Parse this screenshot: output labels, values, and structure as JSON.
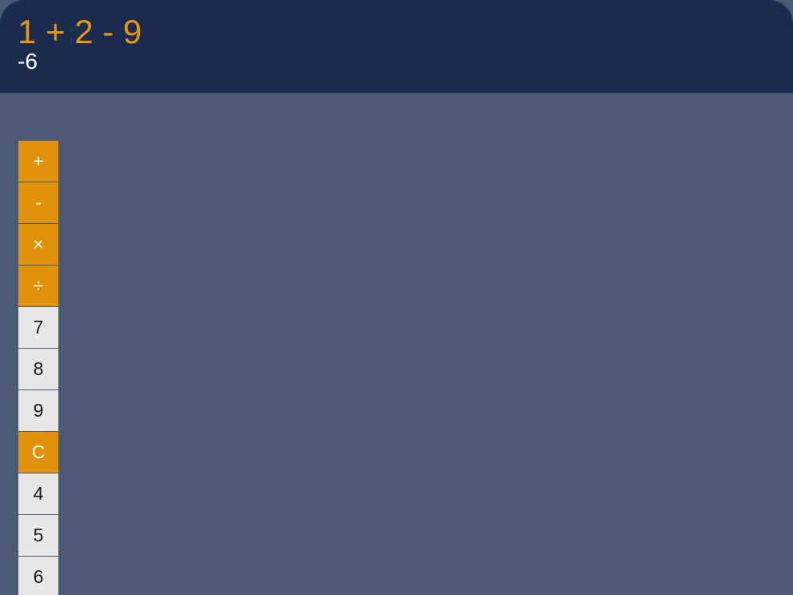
{
  "display": {
    "expression": "1 + 2 - 9",
    "result": "-6"
  },
  "keys": [
    {
      "label": "+",
      "kind": "op",
      "name": "add-button"
    },
    {
      "label": "-",
      "kind": "op",
      "name": "subtract-button"
    },
    {
      "label": "×",
      "kind": "op",
      "name": "multiply-button"
    },
    {
      "label": "÷",
      "kind": "op",
      "name": "divide-button"
    },
    {
      "label": "7",
      "kind": "num",
      "name": "digit-7-button"
    },
    {
      "label": "8",
      "kind": "num",
      "name": "digit-8-button"
    },
    {
      "label": "9",
      "kind": "num",
      "name": "digit-9-button"
    },
    {
      "label": "C",
      "kind": "clear",
      "name": "clear-button"
    },
    {
      "label": "4",
      "kind": "num",
      "name": "digit-4-button"
    },
    {
      "label": "5",
      "kind": "num",
      "name": "digit-5-button"
    },
    {
      "label": "6",
      "kind": "num",
      "name": "digit-6-button"
    }
  ],
  "colors": {
    "accent": "#e1900a",
    "display_bg": "#1c2b50",
    "body_bg": "#4c5a73",
    "number_key_bg": "#e7e7e7"
  }
}
